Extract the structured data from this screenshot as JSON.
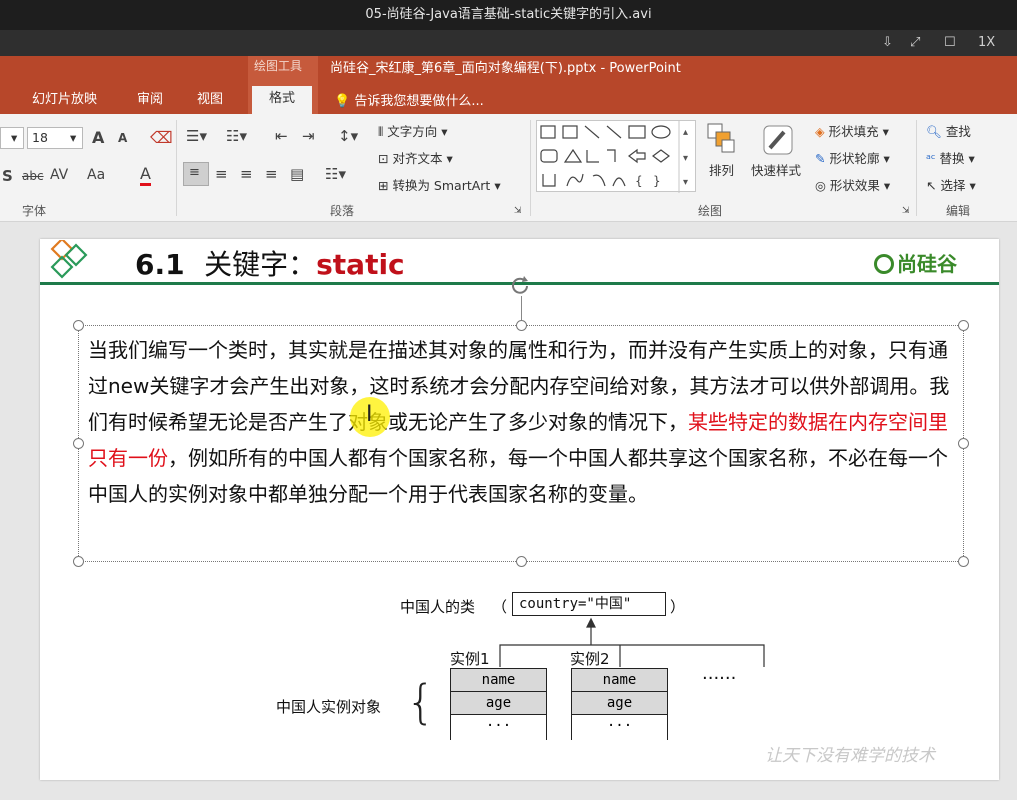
{
  "player": {
    "title": "05-尚硅谷-Java语言基础-static关键字的引入.avi",
    "zoom": "1X"
  },
  "app": {
    "doc_title": "尚硅谷_宋红康_第6章_面向对象编程(下).pptx - PowerPoint",
    "context_tool": "绘图工具",
    "tabs": [
      "幻灯片放映",
      "审阅",
      "视图"
    ],
    "active_tab": "格式",
    "tell_me": "告诉我您想要做什么..."
  },
  "ribbon": {
    "font_size": "18",
    "groups": {
      "font": "字体",
      "paragraph": "段落",
      "drawing": "绘图",
      "editing": "编辑"
    },
    "paragraph": {
      "text_direction": "文字方向",
      "align_text": "对齐文本",
      "convert_smartart": "转换为 SmartArt"
    },
    "drawing": {
      "arrange": "排列",
      "quick_styles": "快速样式",
      "shape_fill": "形状填充",
      "shape_outline": "形状轮廓",
      "shape_effects": "形状效果"
    },
    "editing": {
      "find": "查找",
      "replace": "替换",
      "select": "选择"
    },
    "font_glyphs": {
      "grow": "A",
      "shrink": "A",
      "strike": "abc",
      "spacing": "AV",
      "case": "Aa",
      "color": "A",
      "shadow": "S"
    }
  },
  "slide": {
    "number": "6.1",
    "title_prefix": "关键字：",
    "title_keyword": "static",
    "brand": "尚硅谷",
    "para_part1": "当我们编写一个类时，其实就是在描述其对象的属性和行为，而并没有产生实质上的对象，只有通过new关键字才会产生出对象，这时系统才会分配内存空间给对象，其方法才可以供外部调用。我们有时候希望无论是否产生了对象或无论产生了多少对象的情况下，",
    "para_red": "某些特定的数据在内存空间里只有一份",
    "para_part2": "，例如所有的中国人都有个国家名称，每一个中国人都共享这个国家名称，不必在每一个中国人的实例对象中都单独分配一个用于代表国家名称的变量。",
    "diagram": {
      "class_label": "中国人的类",
      "paren_open": "（",
      "paren_close": "）",
      "country_field": "country=\"中国\"",
      "instance1": "实例1",
      "instance2": "实例2",
      "ellipsis": "······",
      "objects_label": "中国人实例对象",
      "brace": "{",
      "field_name": "name",
      "field_age": "age",
      "dots": "···"
    },
    "watermark": "让天下没有难学的技术"
  }
}
